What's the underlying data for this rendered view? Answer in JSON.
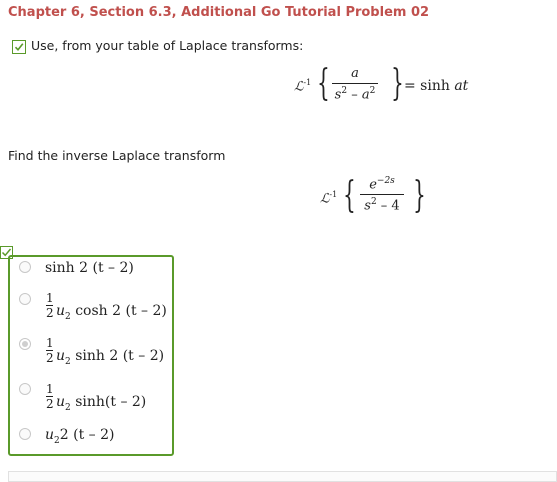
{
  "header": {
    "title": "Chapter 6, Section 6.3, Additional Go Tutorial Problem 02"
  },
  "intro": {
    "text": "Use, from your table of Laplace transforms:"
  },
  "given": {
    "operator": "ℒ",
    "operator_sup": "-1",
    "numerator": "a",
    "den_s": "s",
    "den_minus": " – ",
    "den_a": "a",
    "den_exp": "2",
    "rhs_eq": "= sinh ",
    "rhs_arg": "at"
  },
  "prompt": {
    "text": "Find the inverse Laplace transform"
  },
  "target": {
    "operator": "ℒ",
    "operator_sup": "-1",
    "num_e": "e",
    "num_exp": "−2s",
    "den_s": "s",
    "den_exp": "2",
    "den_rest": " – 4"
  },
  "options": [
    {
      "label": "sinh 2 (t – 2)",
      "prefix_half": false,
      "selected": false
    },
    {
      "half_n": "1",
      "half_d": "2",
      "u": "u",
      "u_sub": "2",
      "rest": " cosh 2 (t – 2)",
      "selected": false
    },
    {
      "half_n": "1",
      "half_d": "2",
      "u": "u",
      "u_sub": "2",
      "rest": " sinh 2 (t – 2)",
      "selected": true
    },
    {
      "half_n": "1",
      "half_d": "2",
      "u": "u",
      "u_sub": "2",
      "rest": " sinh(t – 2)",
      "selected": false
    },
    {
      "u": "u",
      "u_sub": "2",
      "rest": "2 (t – 2)",
      "selected": false
    }
  ],
  "colors": {
    "title": "#c0504d",
    "check_green": "#5a9a2a",
    "radio_border": "#c8c8c8"
  },
  "icons": {
    "intro_check": "checkmark-icon",
    "answer_check": "checkmark-icon"
  }
}
